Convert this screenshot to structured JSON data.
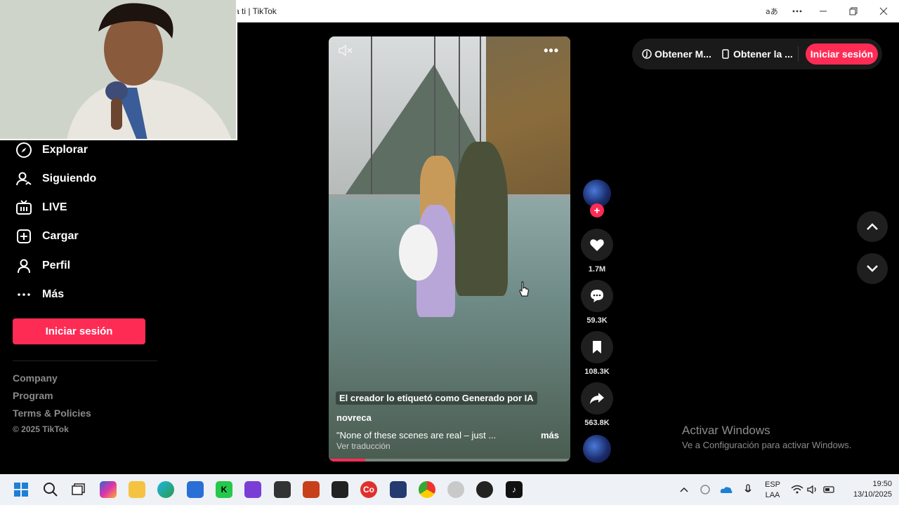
{
  "window": {
    "title": "a ti | TikTok",
    "translate_icon": "translate-icon",
    "more_icon": "more-horizontal-icon",
    "minimize_icon": "minimize-icon",
    "restore_icon": "restore-icon",
    "close_icon": "close-icon"
  },
  "sidebar": {
    "items": [
      {
        "label": "Explorar",
        "icon": "compass-icon"
      },
      {
        "label": "Siguiendo",
        "icon": "following-icon"
      },
      {
        "label": "LIVE",
        "icon": "live-tv-icon"
      },
      {
        "label": "Cargar",
        "icon": "upload-plus-icon"
      },
      {
        "label": "Perfil",
        "icon": "profile-icon"
      },
      {
        "label": "Más",
        "icon": "more-dots-icon"
      }
    ],
    "login_label": "Iniciar sesión",
    "footer_links": [
      "Company",
      "Program",
      "Terms & Policies"
    ],
    "copyright": "© 2025 TikTok"
  },
  "header": {
    "get_coins_label": "Obtener M...",
    "get_app_label": "Obtener la ...",
    "login_label": "Iniciar sesión"
  },
  "video": {
    "ai_label": "El creador lo etiquetó como Generado por IA",
    "author": "novreca",
    "caption": "\"None of these scenes are real – just ...",
    "more_label": "más",
    "translate_label": "Ver traducción",
    "progress": 0.15
  },
  "actions": {
    "likes": "1.7M",
    "comments": "59.3K",
    "saves": "108.3K",
    "shares": "563.8K"
  },
  "watermark": {
    "title": "Activar Windows",
    "subtitle": "Ve a Configuración para activar Windows."
  },
  "taskbar": {
    "lang_top": "ESP",
    "lang_bottom": "LAA",
    "time": "19:50",
    "date": "13/10/2025"
  },
  "colors": {
    "accent": "#fe2c55",
    "background": "#000000",
    "taskbar": "#eef1f5"
  }
}
